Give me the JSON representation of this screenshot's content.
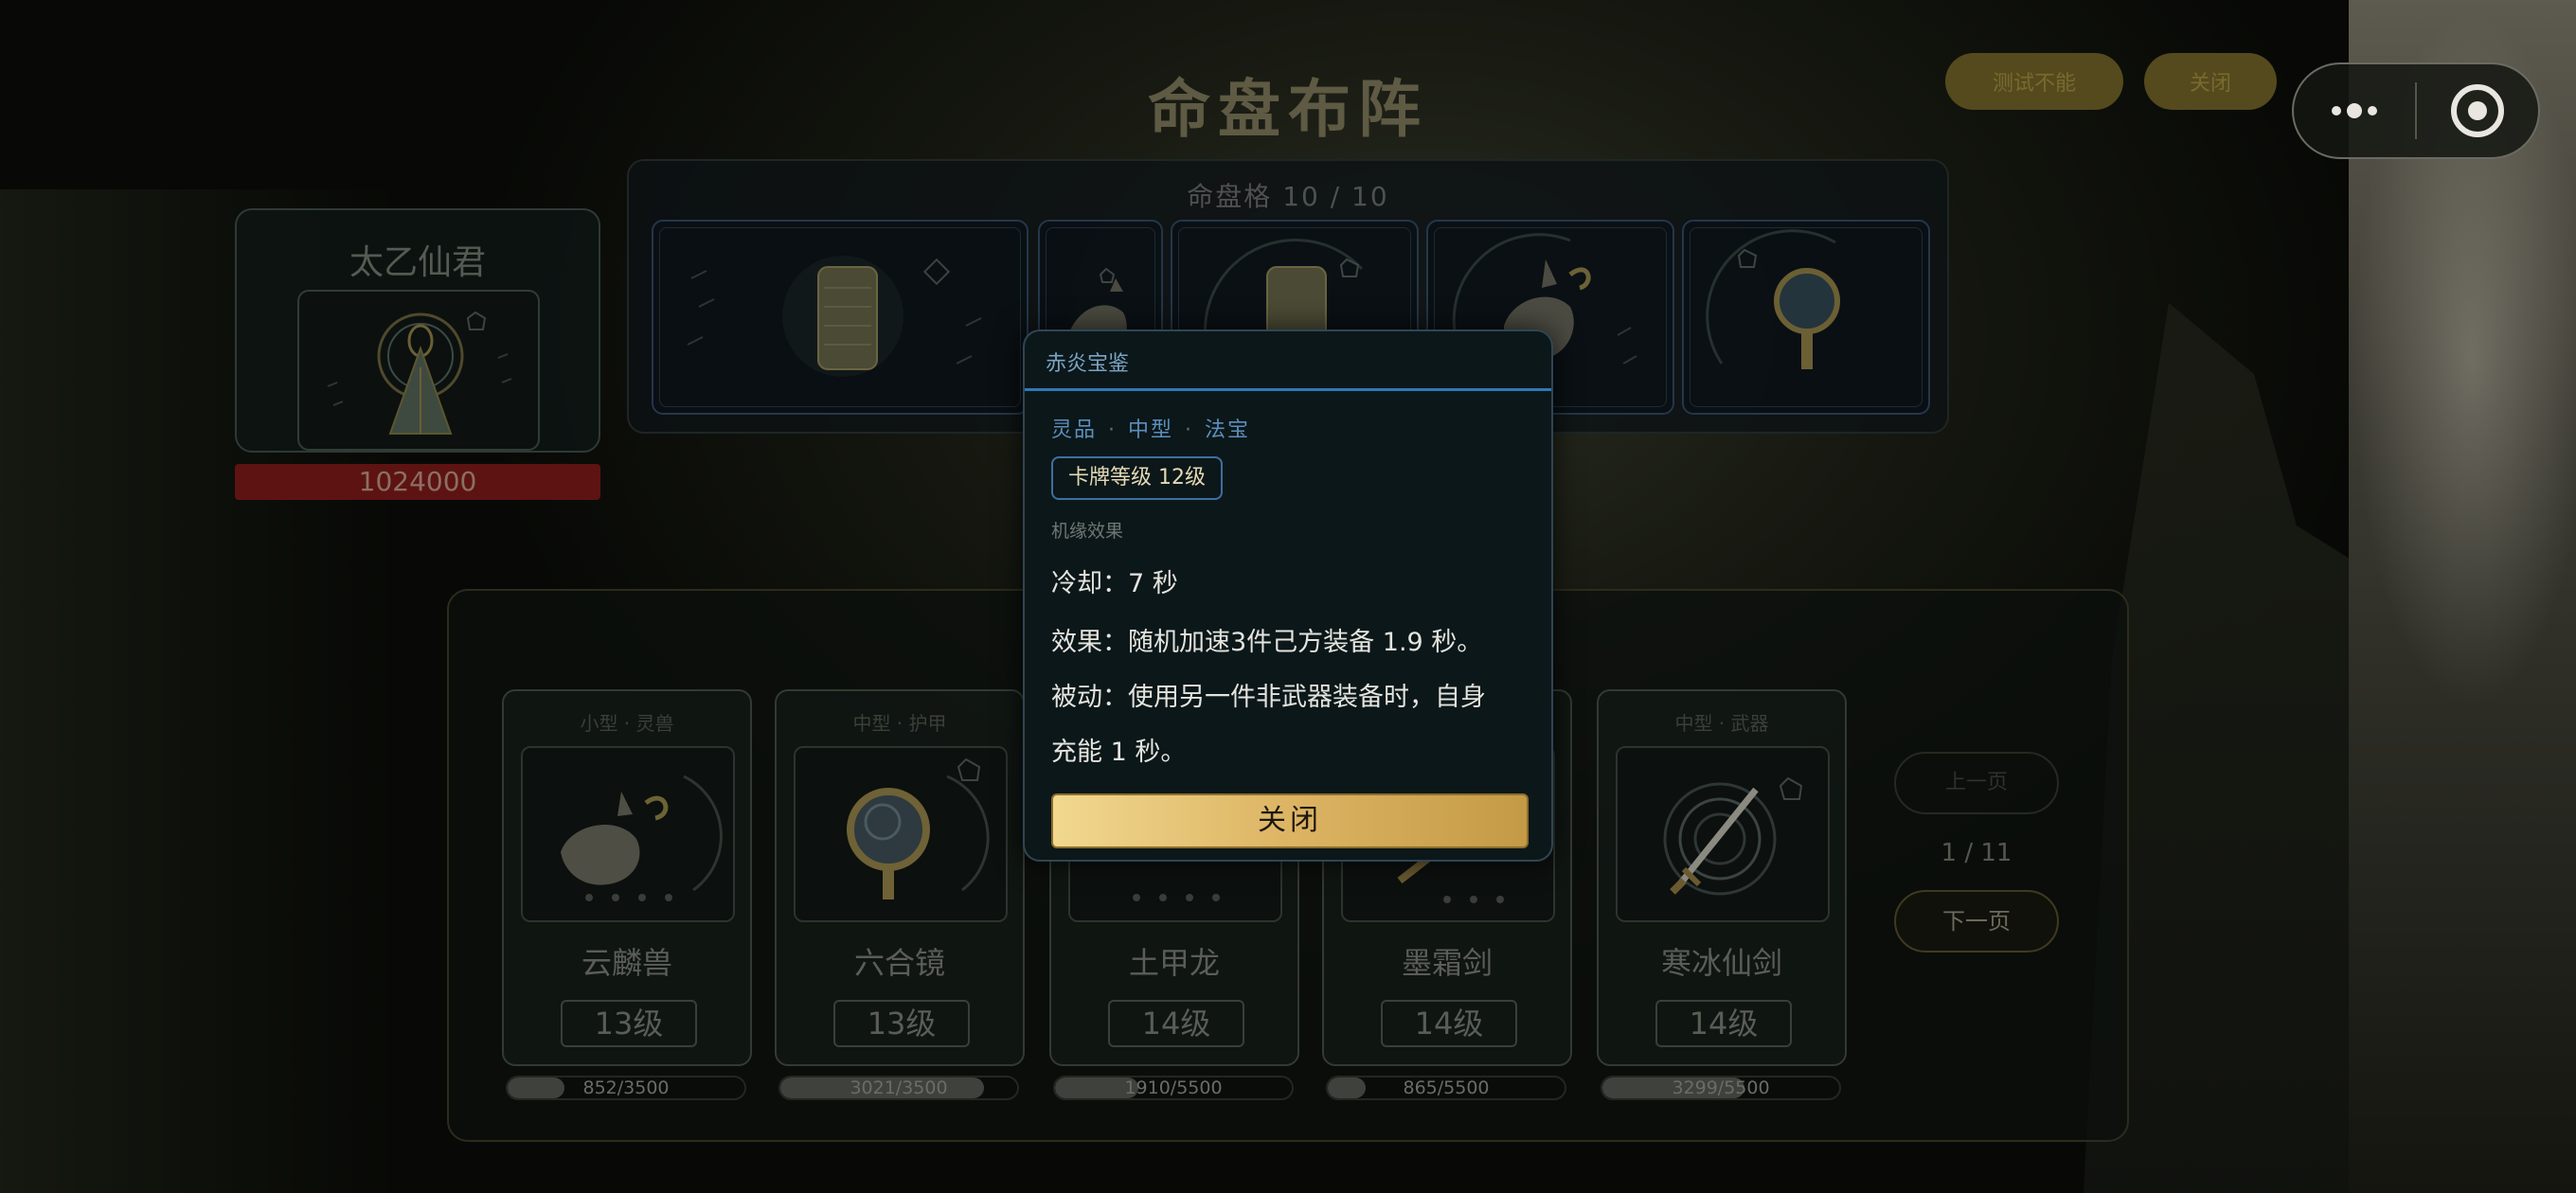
{
  "page": {
    "title": "命盘布阵",
    "buttons": {
      "test": "测试不能",
      "close": "关闭"
    }
  },
  "hero": {
    "name": "太乙仙君",
    "hp": "1024000"
  },
  "board": {
    "caption": "命盘格 10 / 10"
  },
  "cards": [
    {
      "type": "小型 · 灵兽",
      "name": "云麟兽",
      "level": "13级",
      "xp_text": "852/3500",
      "xp_fraction": 0.24,
      "art": "fox-beast-icon"
    },
    {
      "type": "中型 · 护甲",
      "name": "六合镜",
      "level": "13级",
      "xp_text": "3021/3500",
      "xp_fraction": 0.86,
      "art": "mirror-icon"
    },
    {
      "type": "",
      "name": "土甲龙",
      "level": "14级",
      "xp_text": "1910/5500",
      "xp_fraction": 0.35,
      "art": "dragon-icon"
    },
    {
      "type": "",
      "name": "墨霜剑",
      "level": "14级",
      "xp_text": "865/5500",
      "xp_fraction": 0.16,
      "art": "sword-icon"
    },
    {
      "type": "中型 · 武器",
      "name": "寒冰仙剑",
      "level": "14级",
      "xp_text": "3299/5500",
      "xp_fraction": 0.6,
      "art": "ice-sword-icon"
    }
  ],
  "pager": {
    "prev": "上一页",
    "indicator": "1 / 11",
    "next": "下一页"
  },
  "modal": {
    "title": "赤炎宝鉴",
    "tags": [
      "灵品",
      "中型",
      "法宝"
    ],
    "level_badge": "卡牌等级 12级",
    "section_label": "机缘效果",
    "lines": [
      "冷却：7 秒",
      "效果：随机加速3件己方装备 1.9 秒。",
      "被动：使用另一件非武器装备时，自身",
      "充能 1 秒。"
    ],
    "close": "关闭"
  },
  "colors": {
    "accent_blue": "#2e78b8",
    "gold": "#dcb463",
    "hp_red": "#5e1313"
  }
}
